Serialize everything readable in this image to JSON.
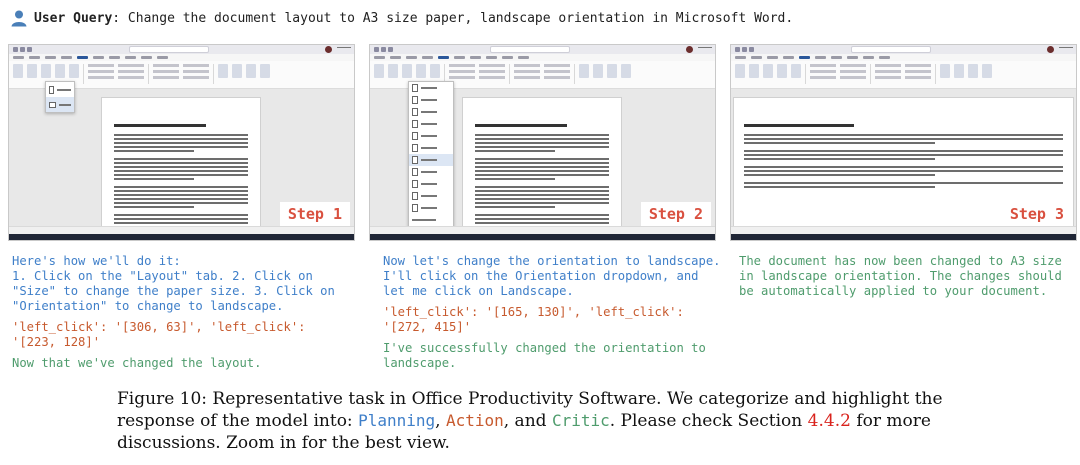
{
  "query": {
    "label": "User Query",
    "text": ": Change the document layout to A3 size paper, landscape orientation in Microsoft Word."
  },
  "steps": [
    {
      "step_label": "Step 1",
      "planning": "Here's how we'll do it:\n1. Click on the \"Layout\" tab. 2. Click on \"Size\" to change the paper size. 3. Click on \"Orientation\" to change to landscape.",
      "action": "'left_click': '[306, 63]', 'left_click': '[223, 128]'",
      "critic": "Now that we've changed the layout."
    },
    {
      "step_label": "Step 2",
      "planning": "Now let's change the orientation to landscape. I'll click on the Orientation dropdown, and let me click on Landscape.",
      "action": "'left_click': '[165, 130]', 'left_click': '[272, 415]'",
      "critic": "I've successfully changed the orientation to landscape."
    },
    {
      "step_label": "Step 3",
      "critic": "The document has now been changed to A3 size in landscape orientation. The changes should be automatically applied to your document."
    }
  ],
  "caption": {
    "prefix": "Figure 10: Representative task in Office Productivity Software. We categorize and highlight the response of the model into: ",
    "planning": "Planning",
    "sep1": ", ",
    "action": "Action",
    "sep2": ", and ",
    "critic": "Critic",
    "middle": ". Please check Section ",
    "ref": "4.4.2",
    "suffix": " for more discussions. Zoom in for the best view."
  },
  "colors": {
    "planning": "#3f7fc9",
    "action": "#c75a2e",
    "critic": "#4f9c6d",
    "step_label": "#d9503f",
    "reference": "#d9231d"
  },
  "icons": {
    "user": "user-icon"
  }
}
